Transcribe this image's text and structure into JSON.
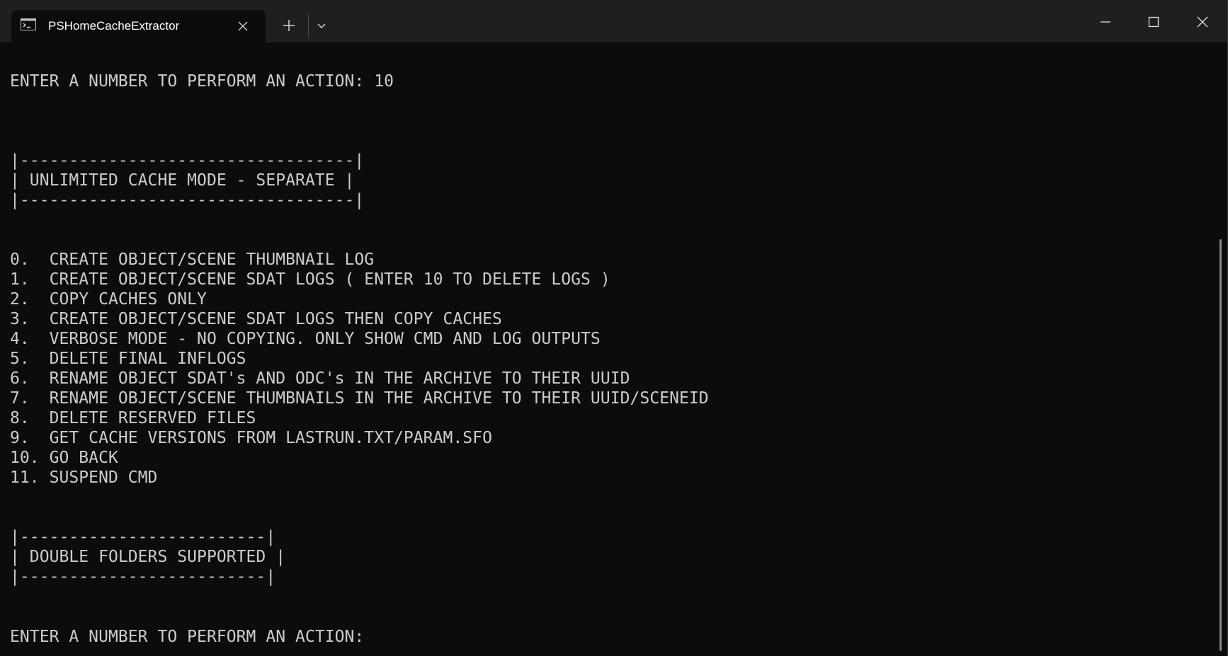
{
  "window": {
    "tab_title": "PSHomeCacheExtractor",
    "icons": {
      "tab": "terminal-icon",
      "close_tab": "close-icon",
      "new_tab": "plus-icon",
      "dropdown": "chevron-down-icon",
      "minimize": "minimize-icon",
      "maximize": "maximize-icon",
      "close_window": "close-icon"
    },
    "colors": {
      "titlebar": "#1f1f1f",
      "terminal_bg": "#0c0c0c",
      "terminal_text": "#cccccc"
    }
  },
  "terminal": {
    "lines": [
      "ENTER A NUMBER TO PERFORM AN ACTION: 10",
      "|----------------------------------|",
      "| UNLIMITED CACHE MODE - SEPARATE |",
      "|----------------------------------|",
      "0.  CREATE OBJECT/SCENE THUMBNAIL LOG",
      "1.  CREATE OBJECT/SCENE SDAT LOGS ( ENTER 10 TO DELETE LOGS )",
      "2.  COPY CACHES ONLY",
      "3.  CREATE OBJECT/SCENE SDAT LOGS THEN COPY CACHES",
      "4.  VERBOSE MODE - NO COPYING. ONLY SHOW CMD AND LOG OUTPUTS",
      "5.  DELETE FINAL INFLOGS",
      "6.  RENAME OBJECT SDAT's AND ODC's IN THE ARCHIVE TO THEIR UUID",
      "7.  RENAME OBJECT/SCENE THUMBNAILS IN THE ARCHIVE TO THEIR UUID/SCENEID",
      "8.  DELETE RESERVED FILES",
      "9.  GET CACHE VERSIONS FROM LASTRUN.TXT/PARAM.SFO",
      "10. GO BACK",
      "11. SUSPEND CMD",
      "|-------------------------|",
      "| DOUBLE FOLDERS SUPPORTED |",
      "|-------------------------|",
      "ENTER A NUMBER TO PERFORM AN ACTION:"
    ]
  }
}
